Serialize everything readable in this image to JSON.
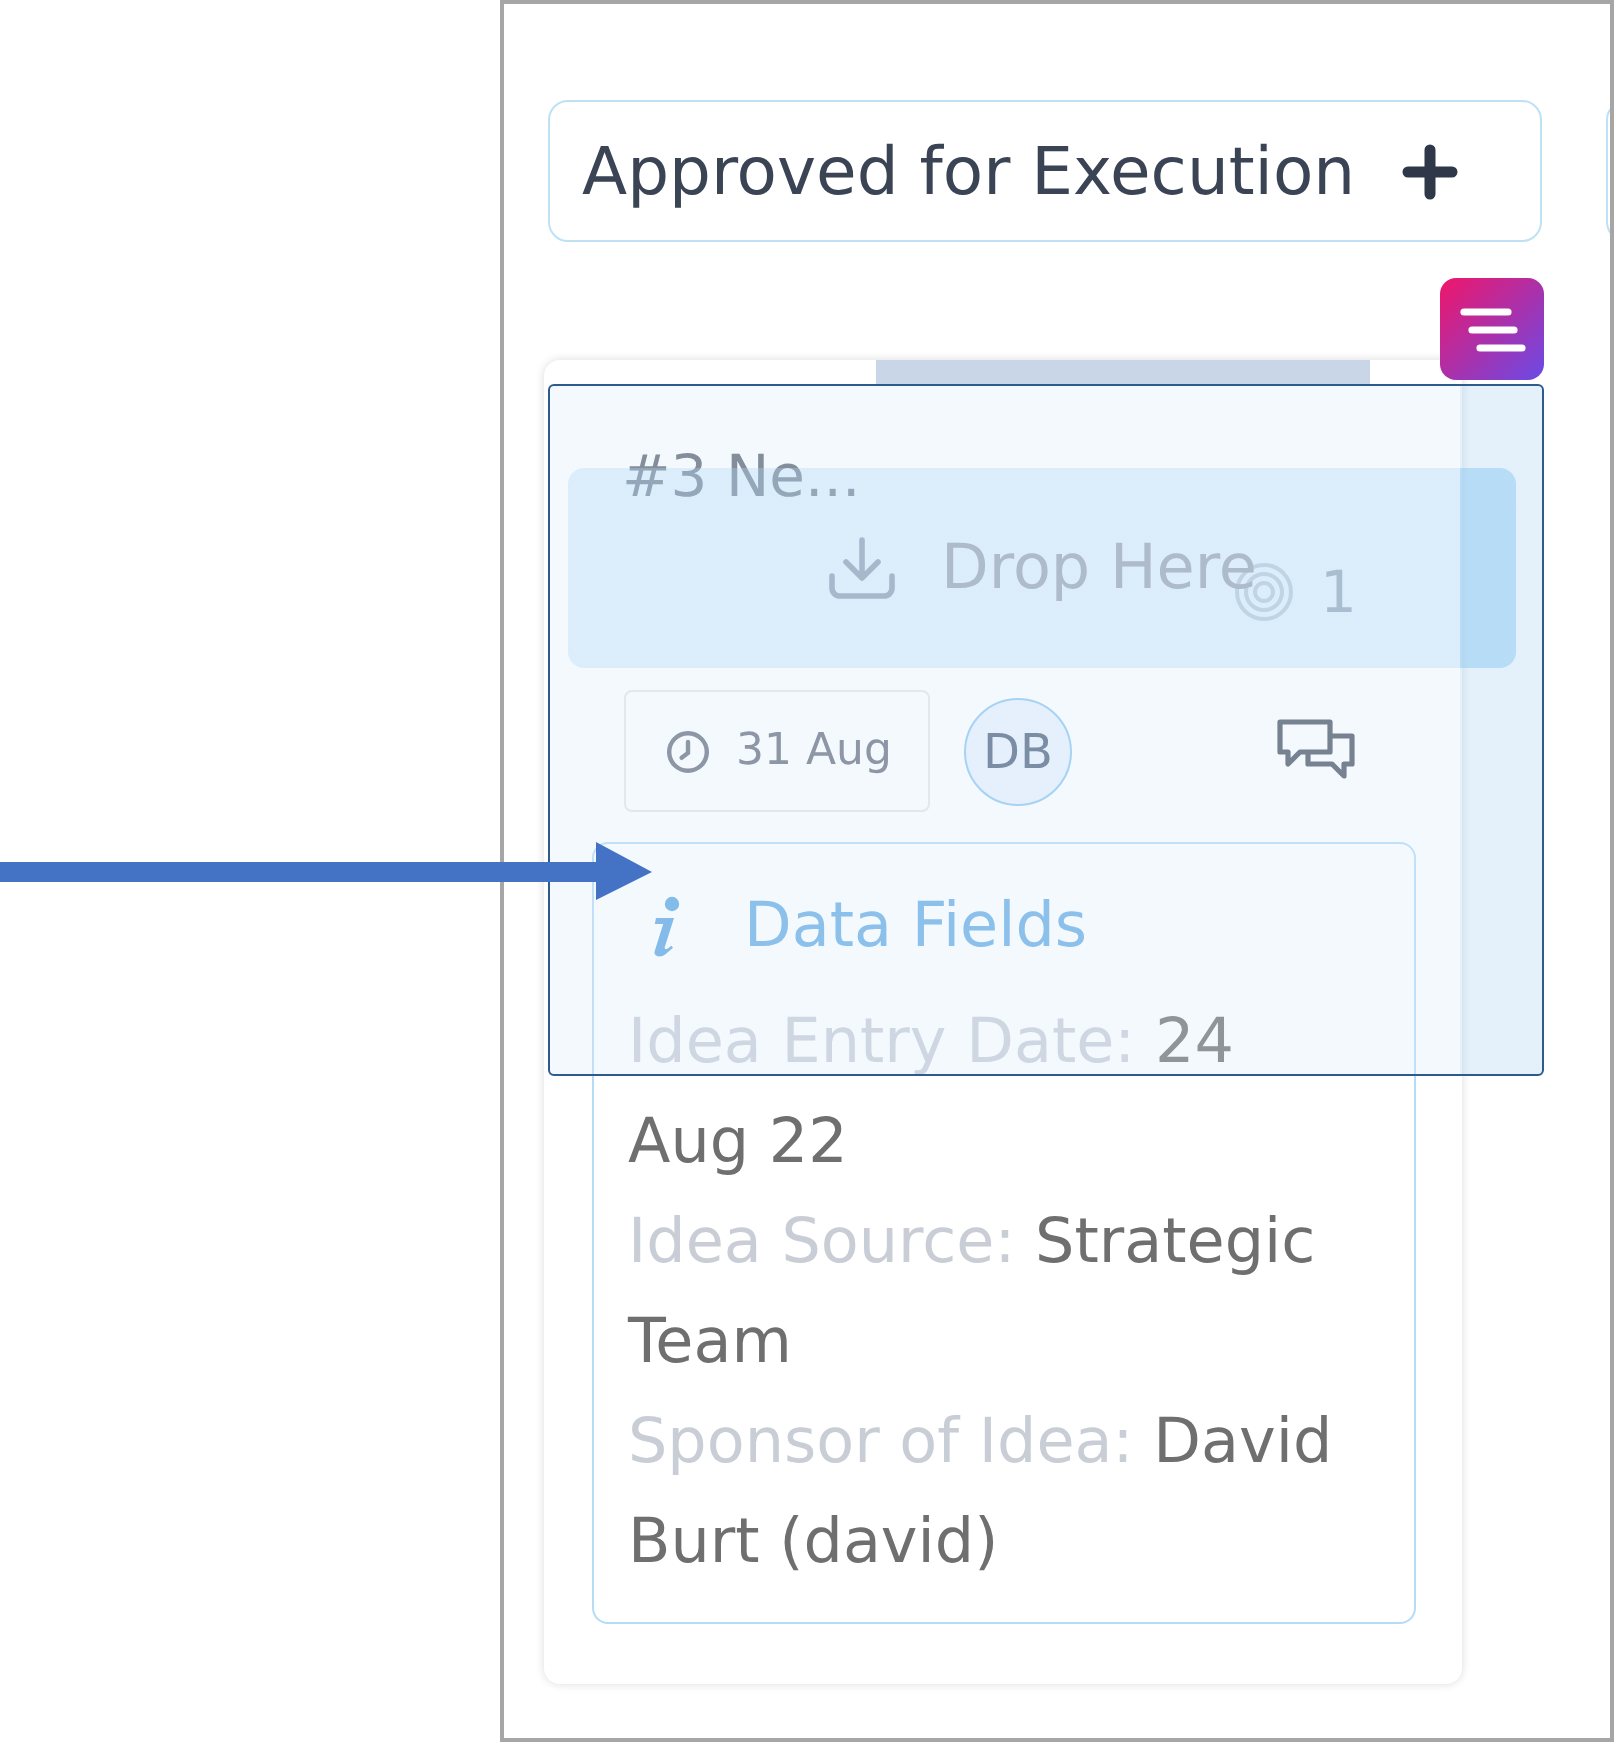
{
  "column": {
    "title": "Approved for Execution"
  },
  "card": {
    "title": "#3 Ne...",
    "count": "1",
    "due_date": "31 Aug",
    "assignee": "DB",
    "data_fields": {
      "title": "Data Fields",
      "fields": [
        {
          "label": "Idea Entry Date:",
          "value": "24 Aug 22"
        },
        {
          "label": "Idea Source:",
          "value": "Strategic Team"
        },
        {
          "label": "Sponsor of Idea:",
          "value": "David Burt (david)"
        }
      ]
    }
  },
  "drop_zone": {
    "label": "Drop Here"
  }
}
